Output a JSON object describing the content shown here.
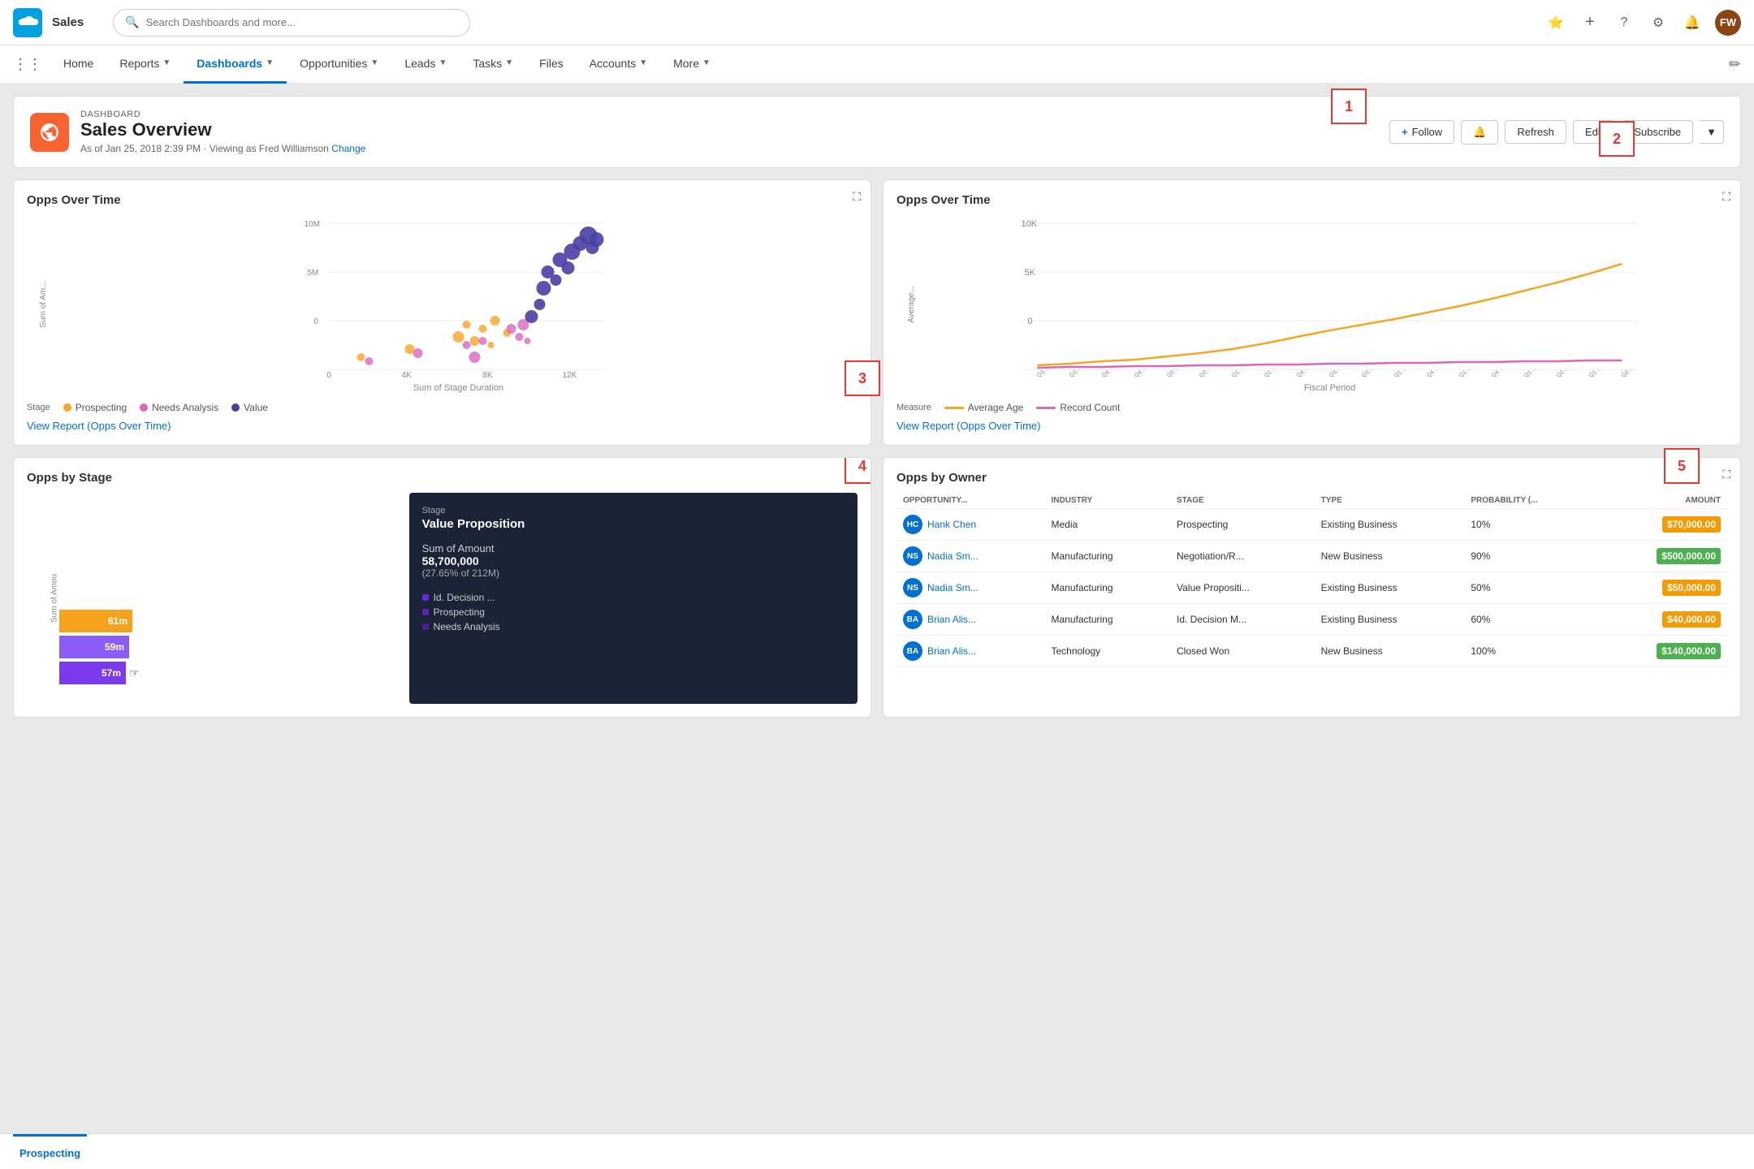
{
  "app": {
    "name": "Sales",
    "search_placeholder": "Search Dashboards and more..."
  },
  "nav": {
    "items": [
      {
        "label": "Home",
        "active": false,
        "has_chevron": false
      },
      {
        "label": "Reports",
        "active": false,
        "has_chevron": true
      },
      {
        "label": "Dashboards",
        "active": true,
        "has_chevron": true
      },
      {
        "label": "Opportunities",
        "active": false,
        "has_chevron": true
      },
      {
        "label": "Leads",
        "active": false,
        "has_chevron": true
      },
      {
        "label": "Tasks",
        "active": false,
        "has_chevron": true
      },
      {
        "label": "Files",
        "active": false,
        "has_chevron": false
      },
      {
        "label": "Accounts",
        "active": false,
        "has_chevron": true
      },
      {
        "label": "More",
        "active": false,
        "has_chevron": true
      }
    ]
  },
  "dashboard": {
    "label": "DASHBOARD",
    "title": "Sales Overview",
    "subtitle": "As of Jan 25, 2018 2:39 PM · Viewing as Fred Williamson",
    "change_link": "Change",
    "annotation1": "1",
    "annotation2": "2",
    "actions": {
      "follow": "Follow",
      "refresh": "Refresh",
      "edit": "Edit",
      "subscribe": "Subscribe"
    }
  },
  "chart1": {
    "title": "Opps Over Time",
    "y_label": "Sum of Am...",
    "x_label": "Sum of Stage Duration",
    "y_ticks": [
      "10M",
      "5M",
      "0"
    ],
    "x_ticks": [
      "0",
      "4K",
      "8K",
      "12K"
    ],
    "legend_label": "Stage",
    "legend_items": [
      {
        "label": "Prospecting",
        "color": "#f5a623"
      },
      {
        "label": "Needs Analysis",
        "color": "#d966c0"
      },
      {
        "label": "Value",
        "color": "#4a3fa5"
      }
    ],
    "view_report_link": "View Report (Opps Over Time)",
    "annotation3": "3"
  },
  "chart2": {
    "title": "Opps Over Time",
    "y_label": "Average...",
    "x_label": "Fiscal Period",
    "y_ticks": [
      "10K",
      "5K",
      "0"
    ],
    "legend_items": [
      {
        "label": "Average Age",
        "color": "#f5a623"
      },
      {
        "label": "Record Count",
        "color": "#d966c0"
      }
    ],
    "view_report_link": "View Report (Opps Over Time)"
  },
  "chart3": {
    "title": "Opps by Stage",
    "y_label": "Sum of Amou",
    "bar_labels": [
      "61m",
      "59m",
      "57m"
    ],
    "bar_colors": [
      "#f5a31c",
      "#8b5cf6",
      "#7c3aed"
    ],
    "tooltip": {
      "stage_label": "Stage",
      "stage_name": "Value Proposition",
      "amount_label": "Sum of Amount",
      "amount_value": "58,700,000",
      "amount_pct": "(27.65% of 212M)",
      "legend_items": [
        {
          "label": "Id. Decision ...",
          "color": "#6d28d9"
        },
        {
          "label": "Prospecting",
          "color": "#5b21b6"
        },
        {
          "label": "Needs Analysis",
          "color": "#4c1d95"
        }
      ]
    },
    "annotation4": "4"
  },
  "chart4": {
    "title": "Opps by Owner",
    "annotation5": "5",
    "columns": [
      "OPPORTUNITY...",
      "INDUSTRY",
      "STAGE",
      "TYPE",
      "PROBABILITY (...",
      "AMOUNT"
    ],
    "rows": [
      {
        "name": "Hank Chen",
        "industry": "Media",
        "stage": "Prospecting",
        "type": "Existing Business",
        "probability": "10%",
        "amount": "$70,000.00",
        "amount_color": "orange",
        "initials": "HC"
      },
      {
        "name": "Nadia Sm...",
        "industry": "Manufacturing",
        "stage": "Negotiation/R...",
        "type": "New Business",
        "probability": "90%",
        "amount": "$500,000.00",
        "amount_color": "green",
        "initials": "NS"
      },
      {
        "name": "Nadia Sm...",
        "industry": "Manufacturing",
        "stage": "Value Propositi...",
        "type": "Existing Business",
        "probability": "50%",
        "amount": "$50,000.00",
        "amount_color": "orange",
        "initials": "NS"
      },
      {
        "name": "Brian Alis...",
        "industry": "Manufacturing",
        "stage": "Id. Decision M...",
        "type": "Existing Business",
        "probability": "60%",
        "amount": "$40,000.00",
        "amount_color": "orange",
        "initials": "BA"
      },
      {
        "name": "Brian Alis...",
        "industry": "Technology",
        "stage": "Closed Won",
        "type": "New Business",
        "probability": "100%",
        "amount": "$140,000.00",
        "amount_color": "green",
        "initials": "BA"
      }
    ]
  },
  "bottom_bar": {
    "tabs": [
      "Prospecting"
    ]
  }
}
